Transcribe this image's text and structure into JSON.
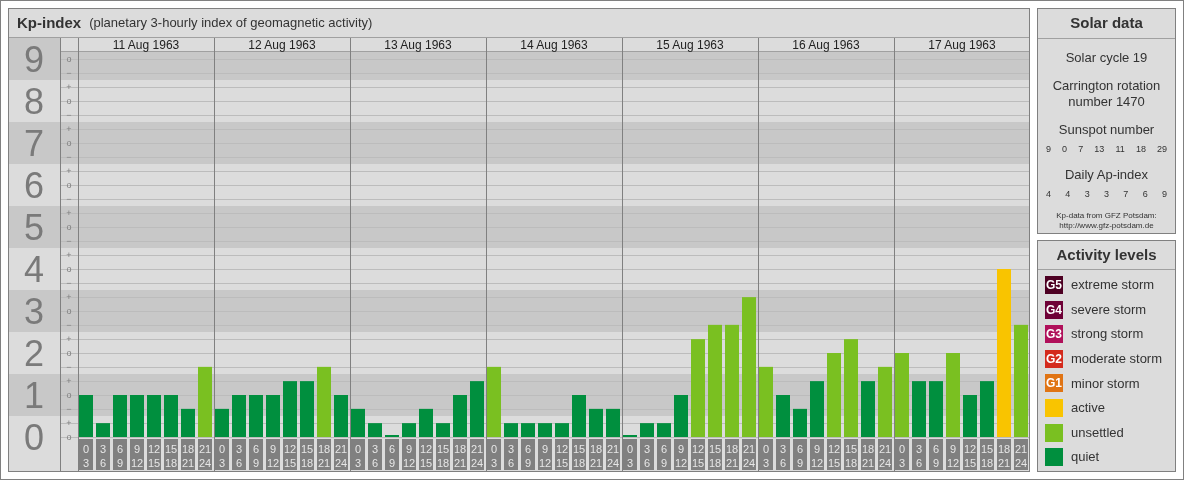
{
  "kp_panel": {
    "subtitle": "(planetary 3-hourly index of geomagnetic activity)",
    "days": [
      "11 Aug 1963",
      "12 Aug 1963",
      "13 Aug 1963",
      "14 Aug 1963",
      "15 Aug 1963",
      "16 Aug 1963",
      "17 Aug 1963"
    ],
    "minor_tick_labels": [
      "o",
      "−",
      "+",
      "o",
      "−",
      "+",
      "o",
      "−",
      "+",
      "o",
      "−",
      "+",
      "o",
      "−",
      "+",
      "o",
      "−",
      "+",
      "o",
      "−",
      "+",
      "o",
      "−",
      "+",
      "o",
      "−",
      "+",
      "o"
    ],
    "chart_data": {
      "type": "bar",
      "title": "Kp-index",
      "ylim": [
        0,
        9.5
      ],
      "grid": true,
      "yticks": [
        0,
        1,
        2,
        3,
        4,
        5,
        6,
        7,
        8,
        9
      ],
      "categories": [
        "0 3",
        "3 6",
        "6 9",
        "9 12",
        "12 15",
        "15 18",
        "18 21",
        "21 24",
        "0 3",
        "3 6",
        "6 9",
        "9 12",
        "12 15",
        "15 18",
        "18 21",
        "21 24",
        "0 3",
        "3 6",
        "6 9",
        "9 12",
        "12 15",
        "15 18",
        "18 21",
        "21 24",
        "0 3",
        "3 6",
        "6 9",
        "9 12",
        "12 15",
        "15 18",
        "18 21",
        "21 24",
        "0 3",
        "3 6",
        "6 9",
        "9 12",
        "12 15",
        "15 18",
        "18 21",
        "21 24",
        "0 3",
        "3 6",
        "6 9",
        "9 12",
        "12 15",
        "15 18",
        "18 21",
        "21 24",
        "0 3",
        "3 6",
        "6 9",
        "9 12",
        "12 15",
        "15 18",
        "18 21",
        "21 24"
      ],
      "series": [
        {
          "color": "#008f3e",
          "values": [
            1,
            0.33,
            1,
            1,
            1,
            1,
            0.67,
            null,
            0.67,
            1,
            1,
            1,
            1.33,
            1.33,
            null,
            1,
            0.67,
            0.33,
            0,
            0.33,
            0.67,
            0.33,
            1,
            1.33,
            null,
            0.33,
            0.33,
            0.33,
            0.33,
            1,
            0.67,
            0.67,
            0,
            0.33,
            0.33,
            1,
            null,
            null,
            null,
            null,
            null,
            1,
            0.67,
            1.33,
            null,
            null,
            1.33,
            null,
            null,
            1.33,
            1.33,
            null,
            1,
            1.33,
            null,
            null
          ]
        },
        {
          "color": "#7ac021",
          "values": [
            null,
            null,
            null,
            null,
            null,
            null,
            null,
            1.67,
            null,
            null,
            null,
            null,
            null,
            null,
            1.67,
            null,
            null,
            null,
            null,
            null,
            null,
            null,
            null,
            null,
            1.67,
            null,
            null,
            null,
            null,
            null,
            null,
            null,
            null,
            null,
            null,
            null,
            2.33,
            2.67,
            2.67,
            3.33,
            1.67,
            null,
            null,
            null,
            2,
            2.33,
            null,
            1.67,
            2,
            null,
            null,
            2,
            null,
            null,
            null,
            2.67
          ]
        },
        {
          "color": "#f9c400",
          "values": [
            null,
            null,
            null,
            null,
            null,
            null,
            null,
            null,
            null,
            null,
            null,
            null,
            null,
            null,
            null,
            null,
            null,
            null,
            null,
            null,
            null,
            null,
            null,
            null,
            null,
            null,
            null,
            null,
            null,
            null,
            null,
            null,
            null,
            null,
            null,
            null,
            null,
            null,
            null,
            null,
            null,
            null,
            null,
            null,
            null,
            null,
            null,
            null,
            null,
            null,
            null,
            null,
            null,
            null,
            4,
            null
          ]
        }
      ]
    }
  },
  "solar_data": {
    "title": "Solar data",
    "solar_cycle": "Solar cycle 19",
    "carrington": "Carrington rotation number 1470",
    "sunspot_label": "Sunspot number",
    "sunspot_numbers": [
      "9",
      "0",
      "7",
      "13",
      "11",
      "18",
      "29"
    ],
    "ap_label": "Daily Ap-index",
    "ap_values": [
      "4",
      "4",
      "3",
      "3",
      "7",
      "6",
      "9"
    ],
    "credit_lines": [
      "Kp-data from GFZ Potsdam:",
      "http://www.gfz-potsdam.de"
    ]
  },
  "activity_levels": {
    "title": "Activity levels",
    "items": [
      {
        "badge": "G5",
        "label": "extreme storm",
        "color": "#4d0022"
      },
      {
        "badge": "G4",
        "label": "severe storm",
        "color": "#6e0036"
      },
      {
        "badge": "G3",
        "label": "strong storm",
        "color": "#b0105a"
      },
      {
        "badge": "G2",
        "label": "moderate storm",
        "color": "#d42a1c"
      },
      {
        "badge": "G1",
        "label": "minor storm",
        "color": "#e07414"
      },
      {
        "label": "active",
        "color": "#f9c400"
      },
      {
        "label": "unsettled",
        "color": "#7ac021"
      },
      {
        "label": "quiet",
        "color": "#008f3e"
      }
    ]
  }
}
